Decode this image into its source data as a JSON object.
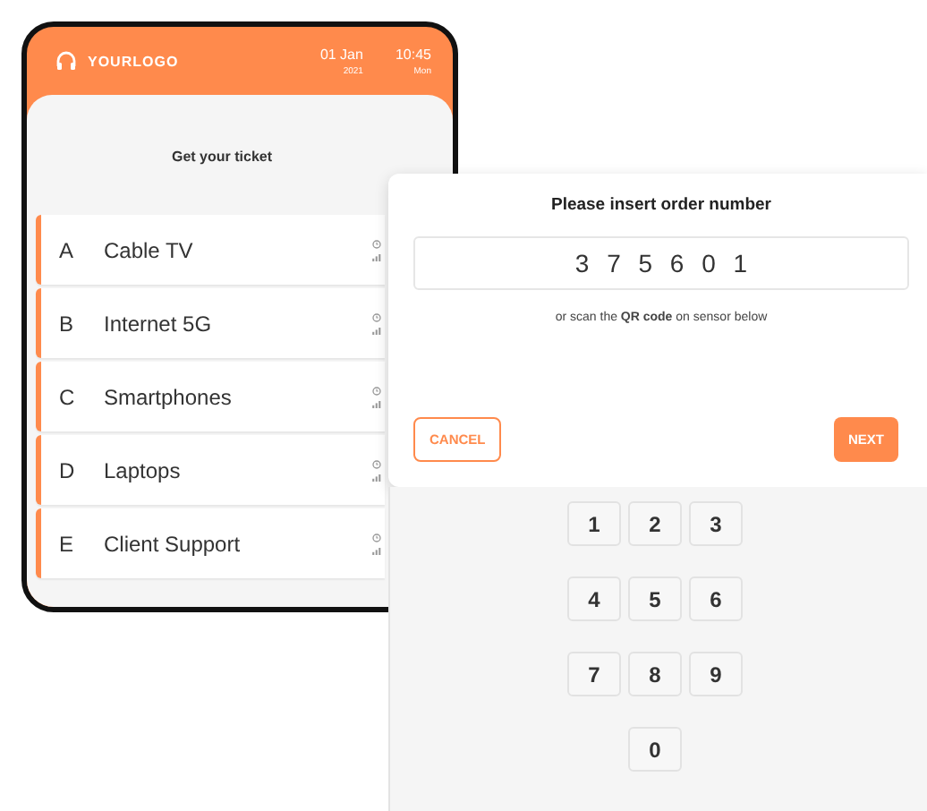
{
  "header": {
    "logo": "YOURLOGO",
    "date": "01 Jan",
    "year": "2021",
    "time": "10:45",
    "weekday": "Mon"
  },
  "title": "Get your ticket",
  "services": [
    {
      "letter": "A",
      "name": "Cable TV"
    },
    {
      "letter": "B",
      "name": "Internet 5G"
    },
    {
      "letter": "C",
      "name": "Smartphones"
    },
    {
      "letter": "D",
      "name": "Laptops"
    },
    {
      "letter": "E",
      "name": "Client Support"
    }
  ],
  "dialog": {
    "title": "Please insert order number",
    "value": "3 7 5 6 0 1",
    "hint": "or scan the **QR code** on sensor below",
    "buttons": [
      {
        "label": "CANCEL",
        "kind": "outline"
      },
      {
        "label": "NEXT",
        "kind": "filled"
      }
    ]
  },
  "keypad": [
    "1",
    "2",
    "3",
    "4",
    "5",
    "6",
    "7",
    "8",
    "9",
    "0"
  ]
}
